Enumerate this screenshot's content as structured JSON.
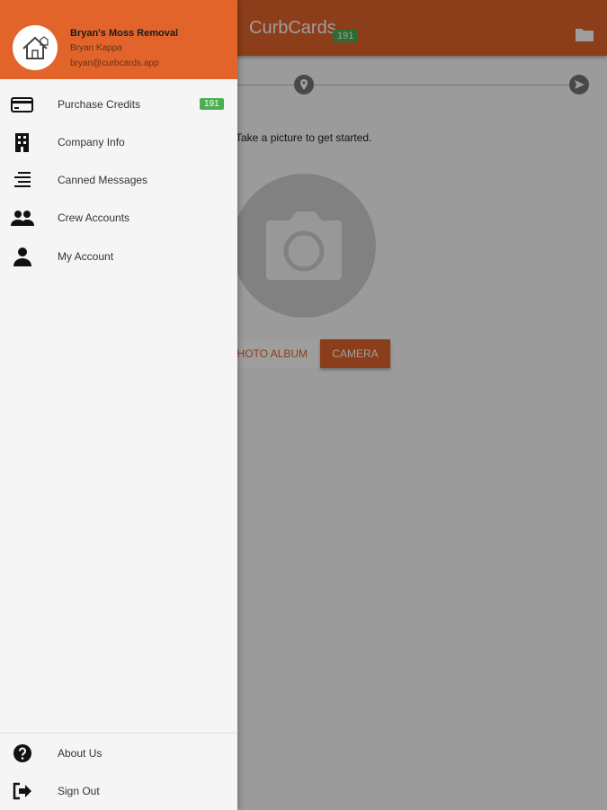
{
  "app": {
    "title": "CurbCards",
    "credit_badge": "191",
    "prompt": "Take a picture to get started.",
    "photo_album_label": "PHOTO ALBUM",
    "camera_label": "CAMERA",
    "steps": [
      "camera-icon",
      "location-pin-icon",
      "send-icon"
    ]
  },
  "drawer": {
    "company_name": "Bryan's Moss Removal",
    "user_name": "Bryan Kappa",
    "user_email": "bryan@curbcards.app",
    "items": [
      {
        "label": "Purchase Credits",
        "icon": "credit-card-icon",
        "badge": "191"
      },
      {
        "label": "Company Info",
        "icon": "building-icon"
      },
      {
        "label": "Canned Messages",
        "icon": "message-list-icon"
      },
      {
        "label": "Crew Accounts",
        "icon": "people-icon"
      },
      {
        "label": "My Account",
        "icon": "person-icon"
      }
    ],
    "footer_items": [
      {
        "label": "About Us",
        "icon": "help-icon"
      },
      {
        "label": "Sign Out",
        "icon": "sign-out-icon"
      }
    ]
  },
  "colors": {
    "brand": "#e2642a",
    "badge": "#4caf50",
    "scrim": "rgba(0,0,0,0.38)"
  }
}
